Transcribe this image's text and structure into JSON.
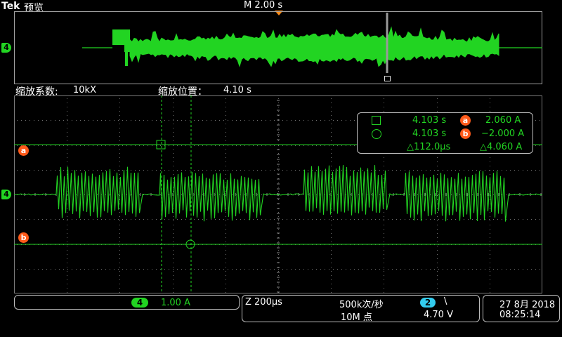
{
  "header": {
    "brand": "Tek",
    "mode": "预览",
    "horizontal_scale": "M 2.00 s"
  },
  "zoom_info": {
    "factor_label": "缩放系数:",
    "factor_value": "10kX",
    "position_label": "缩放位置：",
    "position_value": "4.10 s"
  },
  "channel_markers": {
    "overview_ch": "4",
    "main_ch": "4"
  },
  "cursors": {
    "a_label": "a",
    "b_label": "b"
  },
  "readout": {
    "square_time": "4.103 s",
    "circle_time": "4.103 s",
    "delta_time": "△112.0µs",
    "a_value": "2.060 A",
    "b_value": "−2.000 A",
    "delta_value": "△4.060 A"
  },
  "channel_panel": {
    "channel": "4",
    "scale": "1.00 A"
  },
  "acq_panel": {
    "zoom_time": "Z 200µs",
    "sample_rate": "500k次/秒",
    "record_length": "10M 点",
    "trigger_channel": "2",
    "trigger_slope": "\\",
    "trigger_level": "4.70 V"
  },
  "datetime": {
    "date": "27 8月 2018",
    "time": "08:25:14"
  },
  "colors": {
    "waveform": "#22d422",
    "cursor": "#ff5a1a",
    "ch2": "#33ccee",
    "grid": "#6e6e6e",
    "panel_border": "#bdbdbd"
  },
  "icons": {
    "trigger_pos": "orange-triangle-down-icon",
    "zoom_box": "zoom-bracket-icon",
    "square": "square-cursor-icon",
    "circle": "circle-cursor-icon"
  }
}
